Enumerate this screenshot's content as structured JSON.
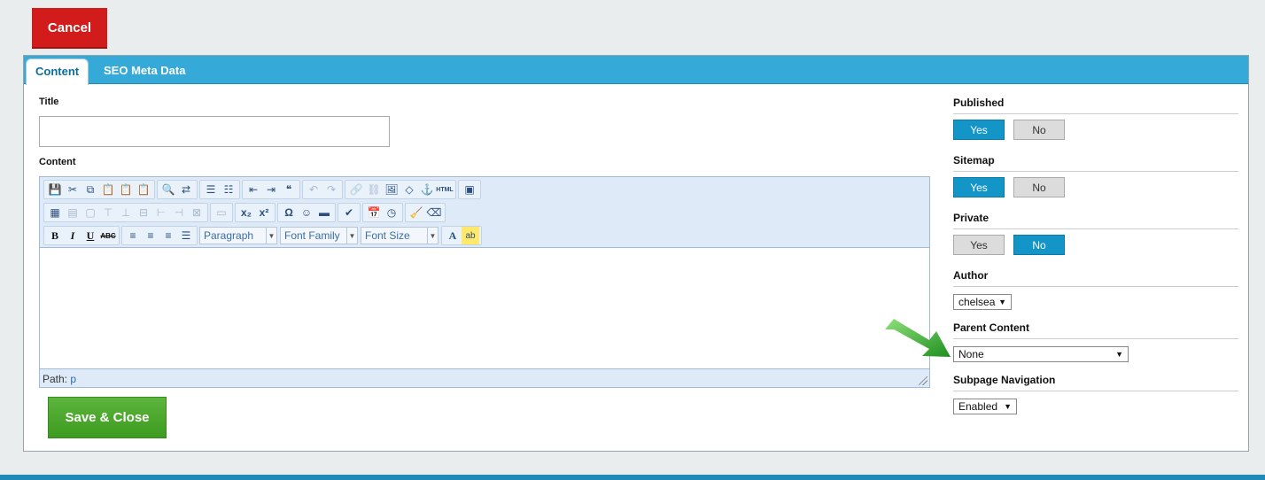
{
  "cancel_label": "Cancel",
  "tabs": [
    {
      "label": "Content"
    },
    {
      "label": "SEO Meta Data"
    }
  ],
  "form": {
    "title_label": "Title",
    "title_value": "",
    "content_label": "Content",
    "editor": {
      "format_select": "Paragraph",
      "font_family_select": "Font Family",
      "font_size_select": "Font Size",
      "path_label": "Path:",
      "path_value": "p"
    },
    "save_label": "Save & Close"
  },
  "sidebar": {
    "published": {
      "label": "Published",
      "yes": "Yes",
      "no": "No",
      "value": "Yes"
    },
    "sitemap": {
      "label": "Sitemap",
      "yes": "Yes",
      "no": "No",
      "value": "Yes"
    },
    "private": {
      "label": "Private",
      "yes": "Yes",
      "no": "No",
      "value": "No"
    },
    "author": {
      "label": "Author",
      "value": "chelsea"
    },
    "parent_content": {
      "label": "Parent Content",
      "value": "None"
    },
    "subpage_navigation": {
      "label": "Subpage Navigation",
      "value": "Enabled"
    }
  },
  "colors": {
    "accent": "#1495c8",
    "cancel": "#d21c1c",
    "save": "#4aa52c",
    "tabbar": "#35a9d8",
    "arrow": "#2fa82f"
  }
}
